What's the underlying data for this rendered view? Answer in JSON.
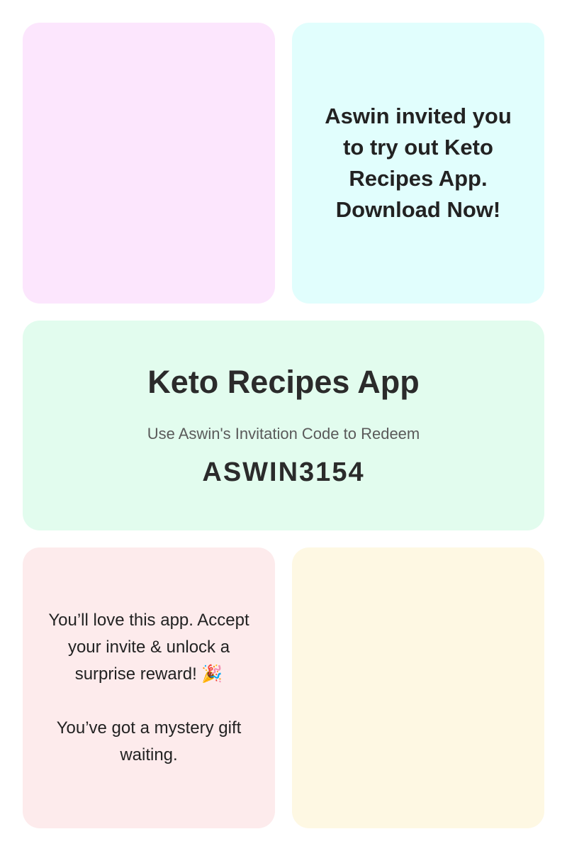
{
  "cards": {
    "top_left": {
      "color": "#fce6fd"
    },
    "top_right": {
      "color": "#e1fefd",
      "invite_text": "Aswin invited you to try out Keto Recipes App. Download Now!"
    },
    "middle": {
      "color": "#e2fcee",
      "app_title": "Keto Recipes App",
      "subtitle": "Use Aswin's Invitation Code to Redeem",
      "invitation_code": "ASWIN3154"
    },
    "bottom_left": {
      "color": "#fdebec",
      "promo_text": "You’ll love this app. Accept your invite & unlock a surprise reward! 🎉",
      "promo_secondary": "You’ve got a mystery gift waiting."
    },
    "bottom_right": {
      "color": "#fef8e3"
    }
  }
}
